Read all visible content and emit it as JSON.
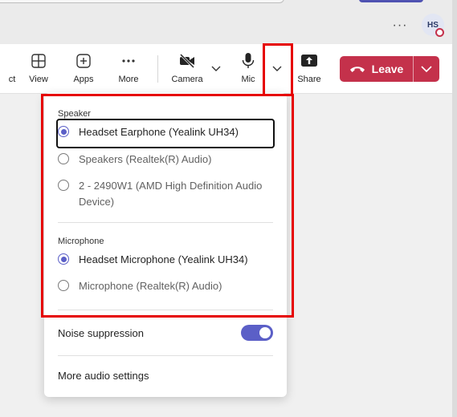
{
  "header": {
    "overflow_glyph": "···",
    "avatar_initials": "HS"
  },
  "toolbar": {
    "partial_left_label": "ct",
    "view_label": "View",
    "apps_label": "Apps",
    "more_label": "More",
    "camera_label": "Camera",
    "mic_label": "Mic",
    "share_label": "Share",
    "leave_label": "Leave"
  },
  "audio_menu": {
    "speaker_section": "Speaker",
    "speakers": [
      {
        "label": "Headset Earphone (Yealink UH34)",
        "selected": true
      },
      {
        "label": "Speakers (Realtek(R) Audio)",
        "selected": false
      },
      {
        "label": "2 - 2490W1 (AMD High Definition Audio Device)",
        "selected": false
      }
    ],
    "microphone_section": "Microphone",
    "microphones": [
      {
        "label": "Headset Microphone (Yealink UH34)",
        "selected": true
      },
      {
        "label": "Microphone (Realtek(R) Audio)",
        "selected": false
      }
    ],
    "noise_suppression_label": "Noise suppression",
    "noise_suppression_on": true,
    "more_settings_label": "More audio settings"
  },
  "colors": {
    "accent": "#5b5fc7",
    "leave": "#c4314b",
    "highlight": "#e60000"
  }
}
